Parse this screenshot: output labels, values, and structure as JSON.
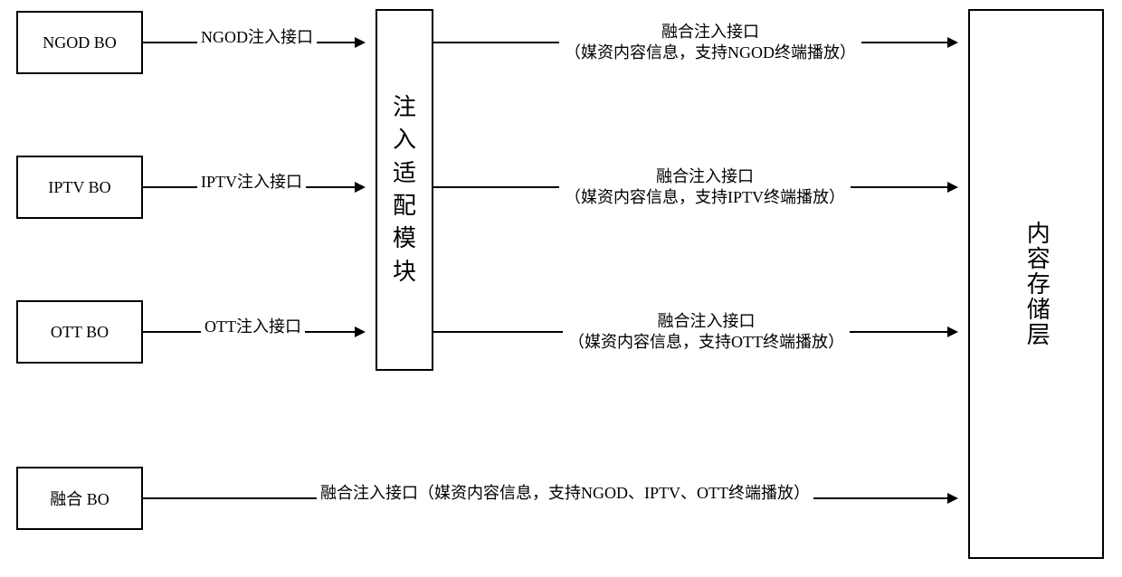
{
  "sources": {
    "ngod": "NGOD BO",
    "iptv": "IPTV BO",
    "ott": "OTT BO",
    "fusion": "融合 BO"
  },
  "adapter": "注入适配模块",
  "storage": "内容存储层",
  "edges": {
    "ngod_in": "NGOD注入接口",
    "iptv_in": "IPTV注入接口",
    "ott_in": "OTT注入接口",
    "ngod_out_title": "融合注入接口",
    "ngod_out_sub": "（媒资内容信息，支持NGOD终端播放）",
    "iptv_out_title": "融合注入接口",
    "iptv_out_sub": "（媒资内容信息，支持IPTV终端播放）",
    "ott_out_title": "融合注入接口",
    "ott_out_sub": "（媒资内容信息，支持OTT终端播放）",
    "fusion_direct": "融合注入接口（媒资内容信息，支持NGOD、IPTV、OTT终端播放）"
  }
}
